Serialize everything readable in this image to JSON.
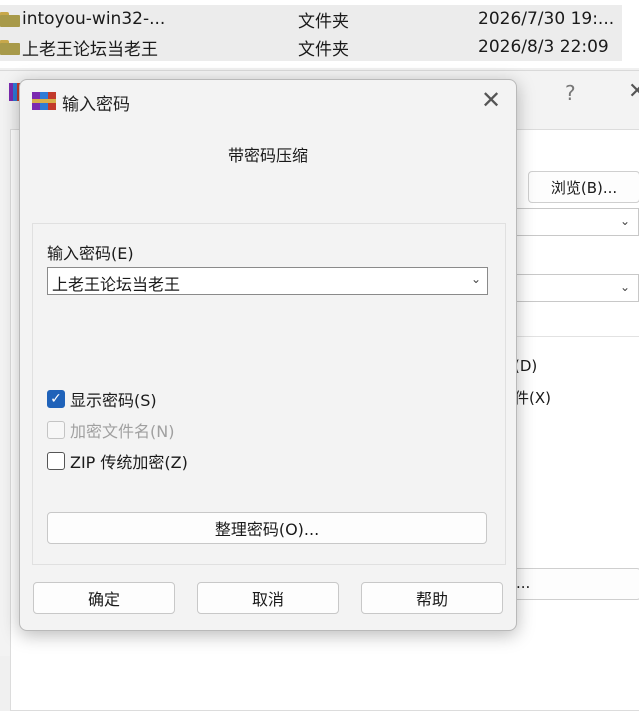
{
  "explorer": {
    "rows": [
      {
        "name": "intoyou-win32-...",
        "type": "文件夹",
        "date": "2026/7/30 19:..."
      },
      {
        "name": "上老王论坛当老王",
        "type": "文件夹",
        "date": "2026/8/3 22:09"
      }
    ]
  },
  "parent_window": {
    "help_glyph": "?",
    "browse_label": "浏览(B)...",
    "option_1": "(D)",
    "option_2": "件(X)",
    "lower_button": "..."
  },
  "dialog": {
    "title": "输入密码",
    "subtitle": "带密码压缩",
    "password_label": "输入密码(E)",
    "password_value": "上老王论坛当老王",
    "show_password": {
      "label": "显示密码(S)",
      "checked": true
    },
    "encrypt_filenames": {
      "label": "加密文件名(N)",
      "checked": false,
      "disabled": true
    },
    "zip_legacy": {
      "label": "ZIP 传统加密(Z)",
      "checked": false
    },
    "organize_button": "整理密码(O)...",
    "ok_button": "确定",
    "cancel_button": "取消",
    "help_button": "帮助"
  },
  "icons": {
    "close": "close-icon",
    "chevron": "chevron-down-icon",
    "check": "checkmark-icon"
  },
  "colors": {
    "accent": "#1f62b9",
    "dialog_bg": "#f3f3f3"
  }
}
